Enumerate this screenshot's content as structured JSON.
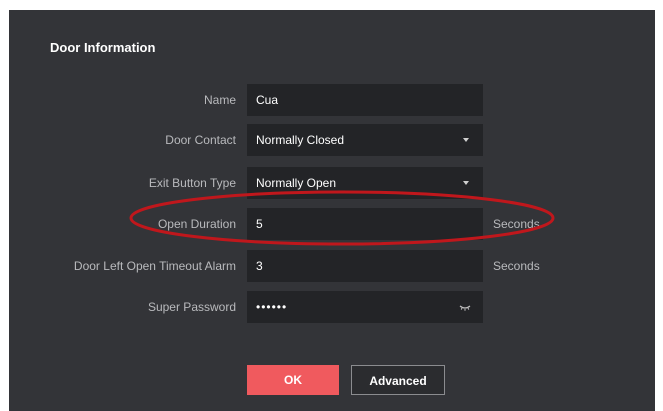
{
  "panel": {
    "title": "Door Information"
  },
  "fields": {
    "name": {
      "label": "Name",
      "value": "Cua"
    },
    "door_contact": {
      "label": "Door Contact",
      "value": "Normally Closed"
    },
    "exit_button_type": {
      "label": "Exit Button Type",
      "value": "Normally Open"
    },
    "open_duration": {
      "label": "Open Duration",
      "value": "5",
      "unit": "Seconds"
    },
    "door_left_open_timeout_alarm": {
      "label": "Door Left Open Timeout Alarm",
      "value": "3",
      "unit": "Seconds"
    },
    "super_password": {
      "label": "Super Password",
      "value": "••••••"
    }
  },
  "buttons": {
    "ok_label": "OK",
    "advanced_label": "Advanced"
  },
  "icons": {
    "dropdown": "chevron-down-icon",
    "password_toggle": "eye-closed-icon"
  },
  "colors": {
    "panel_background": "#333438",
    "field_background": "#232427",
    "primary_button": "#f05a5e",
    "annotation_ellipse": "#c0171c"
  }
}
